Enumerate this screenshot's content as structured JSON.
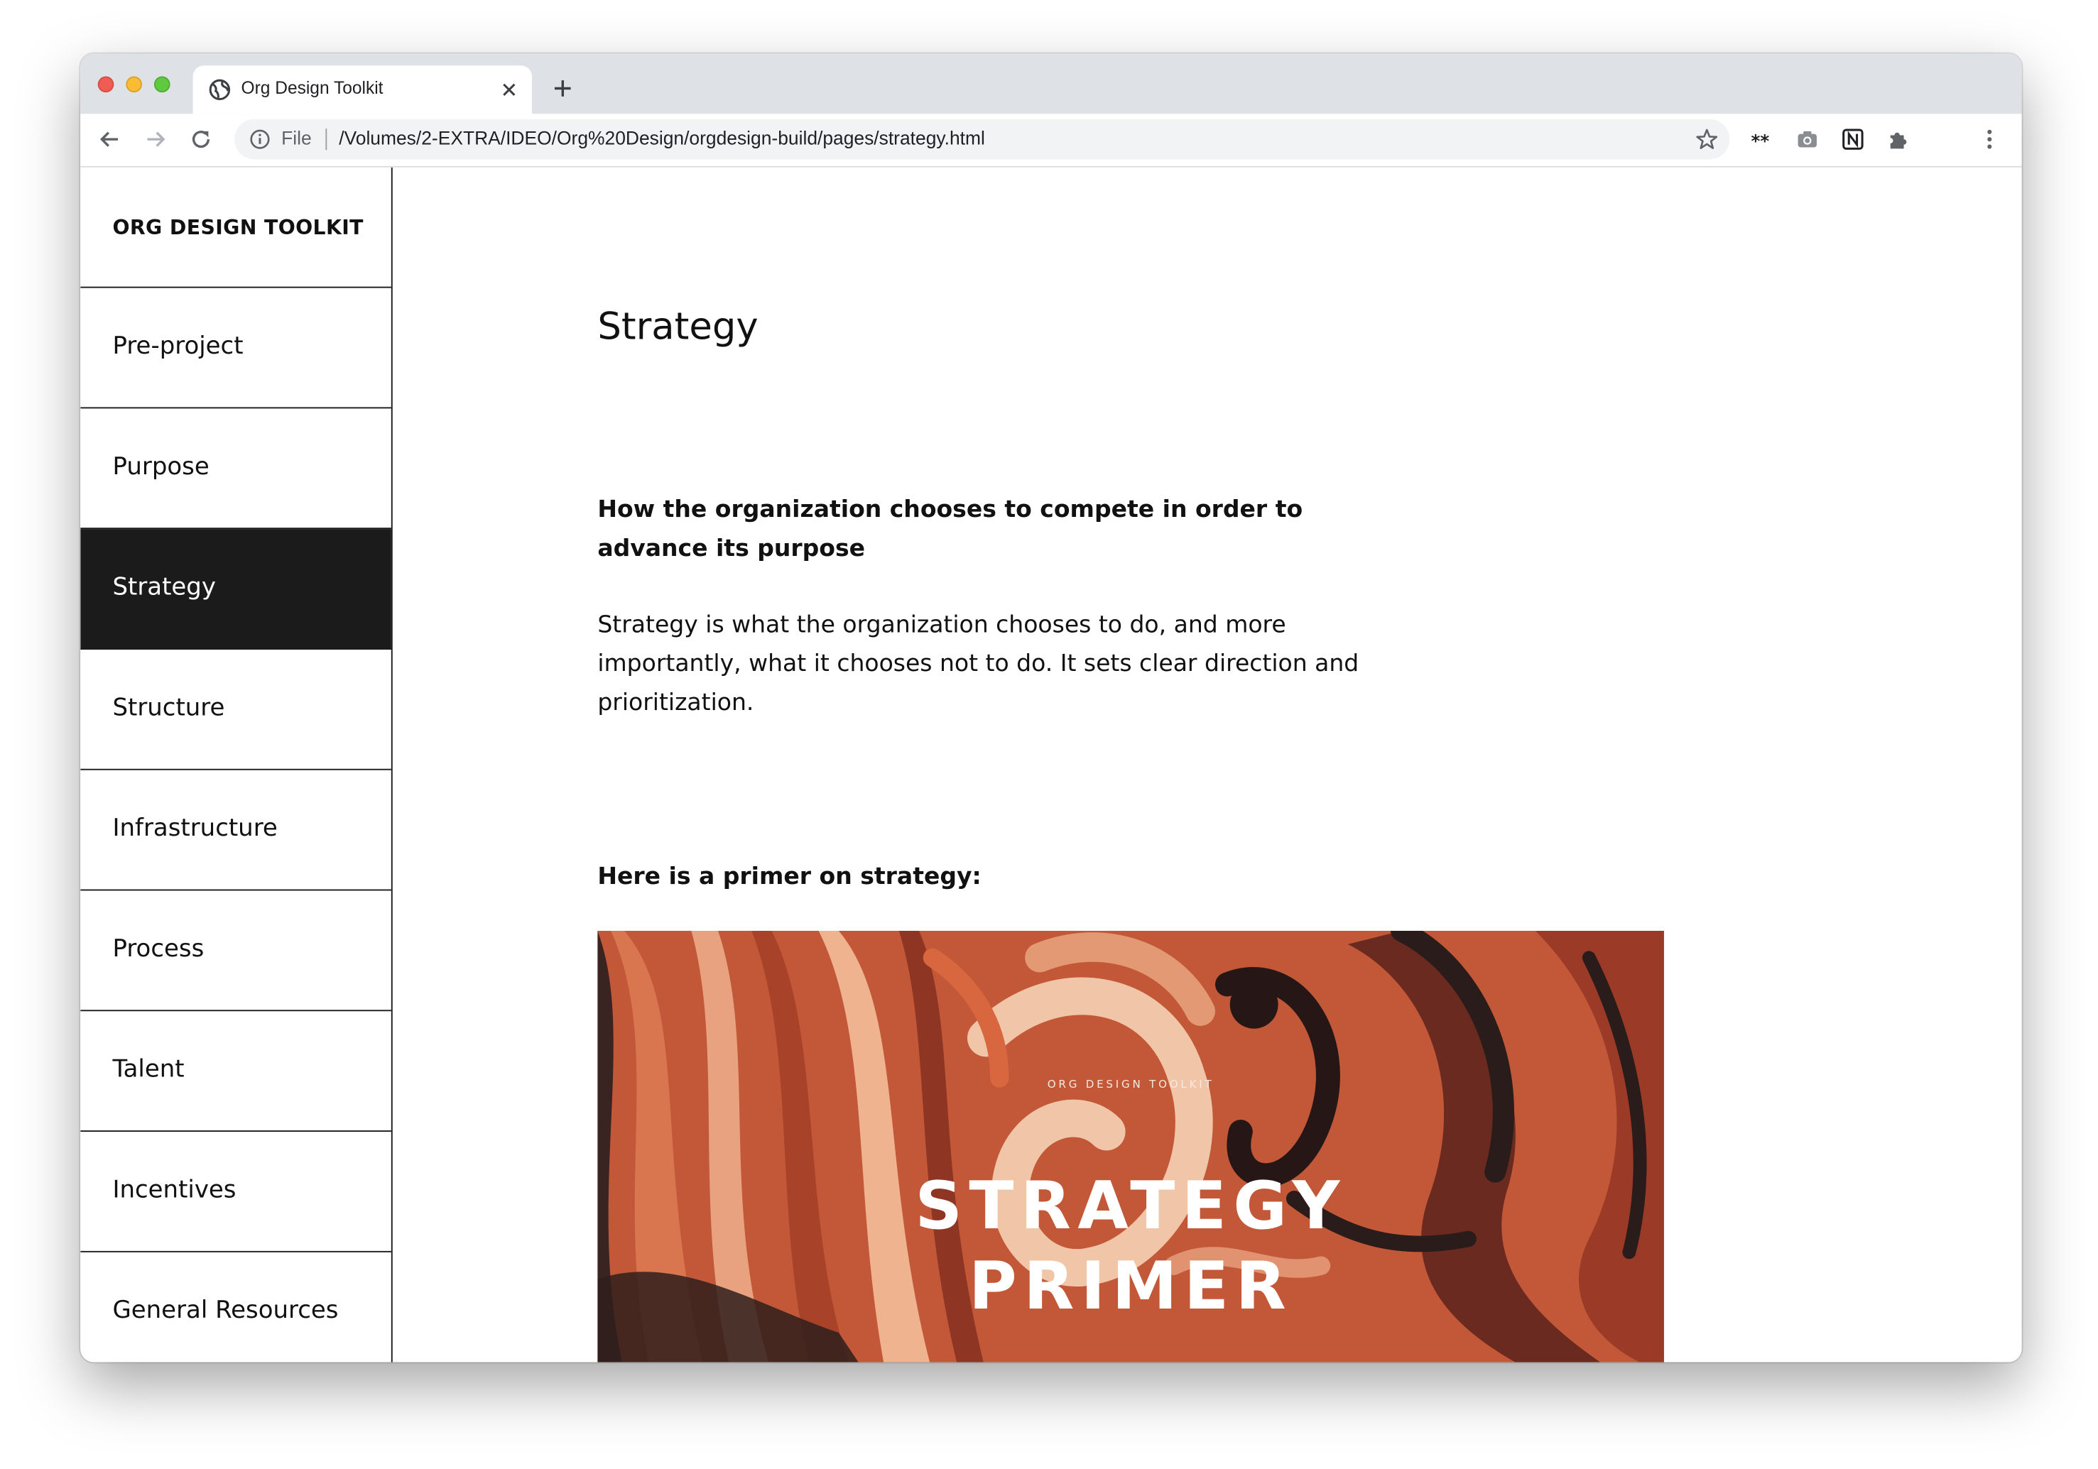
{
  "browser": {
    "tab": {
      "title": "Org Design Toolkit"
    },
    "address_bar": {
      "scheme_label": "File",
      "url": "/Volumes/2-EXTRA/IDEO/Org%20Design/orgdesign-build/pages/strategy.html"
    },
    "toolbar_icons": [
      "back-icon",
      "forward-icon",
      "reload-icon",
      "info-icon",
      "star-icon",
      "extension-asterisk-icon",
      "camera-icon",
      "notion-icon",
      "puzzle-icon",
      "kebab-menu-icon"
    ]
  },
  "sidebar": {
    "brand": "ORG DESIGN TOOLKIT",
    "active_item": "Strategy",
    "items": [
      {
        "label": "Pre-project"
      },
      {
        "label": "Purpose"
      },
      {
        "label": "Strategy"
      },
      {
        "label": "Structure"
      },
      {
        "label": "Infrastructure"
      },
      {
        "label": "Process"
      },
      {
        "label": "Talent"
      },
      {
        "label": "Incentives"
      },
      {
        "label": "General Resources"
      }
    ]
  },
  "main": {
    "title": "Strategy",
    "lead": "How the organization chooses to compete in order to advance its purpose",
    "body": "Strategy is what the organization chooses to do, and more importantly, what it chooses not to do. It sets clear direction and prioritization.",
    "primer_label": "Here is a primer on strategy:",
    "primer_card": {
      "eyebrow": "ORG DESIGN TOOLKIT",
      "title_line1": "STRATEGY",
      "title_line2": "PRIMER"
    }
  },
  "colors": {
    "sidebar_active_bg": "#1b1b1b",
    "card_base": "#c25838",
    "card_dark": "#2a1c1a",
    "card_light": "#efb38f"
  }
}
